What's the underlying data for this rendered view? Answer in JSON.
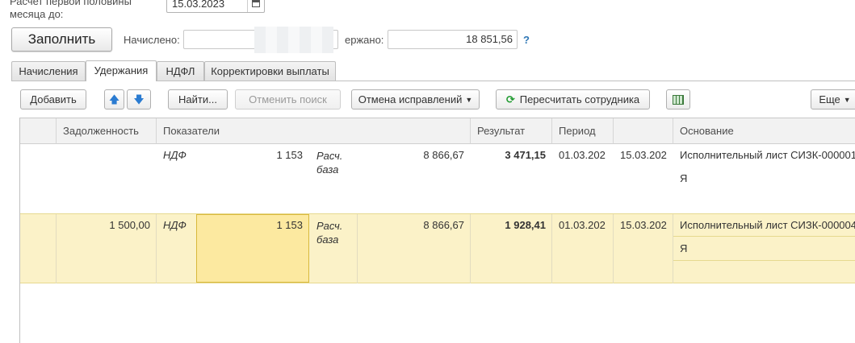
{
  "header": {
    "date_label": "Расчет первой половины месяца до:",
    "date_value": "15.03.2023",
    "fill_button": "Заполнить",
    "accrued_label": "Начислено:",
    "accrued_value": "",
    "withheld_label": "ержано:",
    "withheld_value": "18 851,56",
    "help": "?"
  },
  "tabs": [
    "Начисления",
    "Удержания",
    "НДФЛ",
    "Корректировки выплаты"
  ],
  "active_tab": "Удержания",
  "toolbar": {
    "add": "Добавить",
    "find": "Найти...",
    "cancel_search": "Отменить поиск",
    "cancel_corrections": "Отмена исправлений",
    "recalc": "Пересчитать сотрудника",
    "more": "Еще"
  },
  "grid": {
    "columns": [
      "",
      "Задолженность",
      "Показатели",
      "Результат",
      "Период",
      "",
      "Основание"
    ],
    "rows": [
      {
        "debt": "",
        "indicator1": "НДФ",
        "value1": "1 153",
        "indicator2": "Расч. база",
        "value2": "8 866,67",
        "result": "3 471,15",
        "period_from": "01.03.202",
        "period_to": "15.03.202",
        "basis": "Исполнительный лист СИЗК-000001",
        "basis_extra": "Я"
      },
      {
        "debt": "1 500,00",
        "indicator1": "НДФ",
        "value1": "1 153",
        "indicator2": "Расч. база",
        "value2": "8 866,67",
        "result": "1 928,41",
        "period_from": "01.03.202",
        "period_to": "15.03.202",
        "basis": "Исполнительный лист СИЗК-000004",
        "basis_extra": "Я"
      }
    ]
  },
  "colors": {
    "selected_row": "#fbf2c8",
    "edit_cell": "#fce9a0",
    "accent_blue": "#2a7bd1",
    "refresh_green": "#1e9a2e"
  }
}
